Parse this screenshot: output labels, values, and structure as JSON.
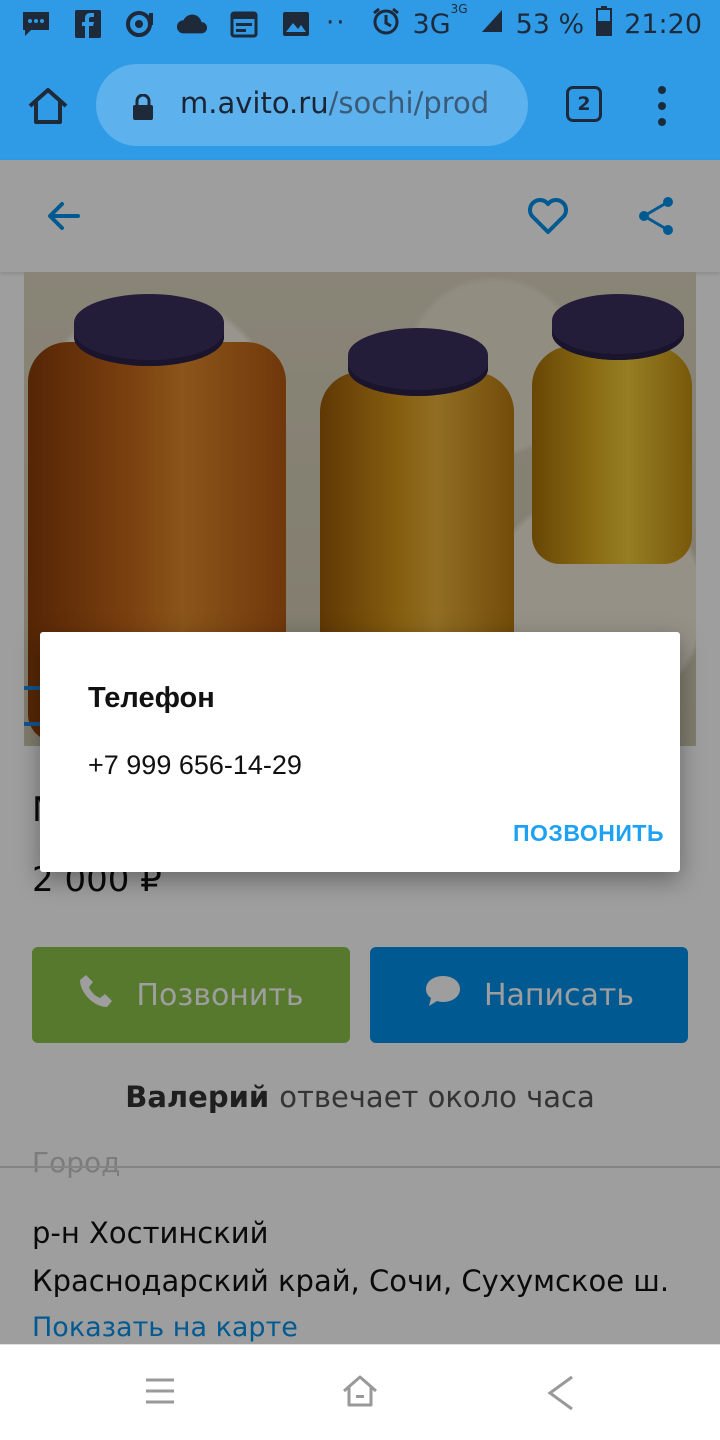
{
  "status_bar": {
    "network": "3G",
    "network_small": "3G",
    "battery": "53 %",
    "time": "21:20",
    "dots": "··",
    "icons": [
      "message-icon",
      "facebook-icon",
      "sync-icon",
      "cloud-icon",
      "calendar-icon",
      "image-icon",
      "alarm-icon",
      "signal-icon",
      "battery-icon"
    ]
  },
  "browser": {
    "url_host": "m.avito.ru",
    "url_path": "/sochi/prod",
    "tab_count": "2"
  },
  "listing": {
    "title_partial": "М",
    "price": "2 000 ₽",
    "call_label": "Позвонить",
    "write_label": "Написать",
    "seller_name": "Валерий",
    "seller_response": "отвечает около часа",
    "section_faint": "Город",
    "address_line1": "р-н Хостинский",
    "address_line2": "Краснодарский край, Сочи, Сухумское ш.",
    "map_link": "Показать на карте"
  },
  "dialog": {
    "title": "Телефон",
    "phone": "+7 999 656-14-29",
    "action": "ПОЗВОНИТЬ"
  },
  "colors": {
    "browser_blue": "#2f9be6",
    "call_green": "#8bc34a",
    "write_blue": "#0091ea",
    "link_blue": "#0091ea",
    "dialog_action": "#1da1f2"
  }
}
